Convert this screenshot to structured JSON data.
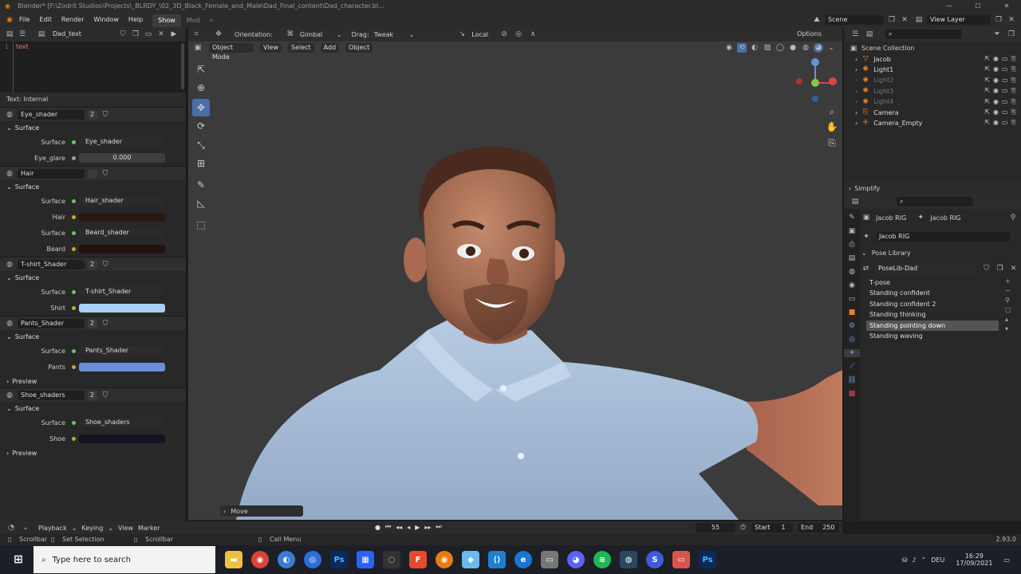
{
  "titlebar": {
    "title": "Blender* [F:\\Zodrit Studios\\Projects\\_BLRDY_\\02_3D_Black_Female_and_Male\\Dad_Final_content\\Dad_character.bl..."
  },
  "menubar": {
    "menus": [
      "File",
      "Edit",
      "Render",
      "Window",
      "Help"
    ],
    "workspaces": [
      "Show",
      "Mod"
    ],
    "scene": "Scene",
    "view_layer": "View Layer"
  },
  "text_editor": {
    "name": "Dad_text",
    "content": "text",
    "footer": "Text: Internal"
  },
  "materials": [
    {
      "name": "Eye_shader",
      "users": "2",
      "section": "Surface",
      "props": [
        {
          "label": "Surface",
          "value": "Eye_shader",
          "kind": "link"
        },
        {
          "label": "Eye_glare",
          "value": "0.000",
          "kind": "number"
        }
      ]
    },
    {
      "name": "Hair",
      "users": "",
      "section": "Surface",
      "props": [
        {
          "label": "Surface",
          "value": "Hair_shader",
          "kind": "link"
        },
        {
          "label": "Hair",
          "value": "",
          "kind": "color",
          "color": "#2a1712"
        },
        {
          "label": "Surface",
          "value": "Beard_shader",
          "kind": "link"
        },
        {
          "label": "Beard",
          "value": "",
          "kind": "color",
          "color": "#211310"
        }
      ]
    },
    {
      "name": "T-shirt_Shader",
      "users": "2",
      "section": "Surface",
      "props": [
        {
          "label": "Surface",
          "value": "T-shirt_Shader",
          "kind": "link"
        },
        {
          "label": "Shirt",
          "value": "",
          "kind": "color",
          "color": "#a9d0f5"
        }
      ]
    },
    {
      "name": "Pants_Shader",
      "users": "2",
      "section": "Surface",
      "props": [
        {
          "label": "Surface",
          "value": "Pants_Shader",
          "kind": "link"
        },
        {
          "label": "Pants",
          "value": "",
          "kind": "color",
          "color": "#6b8fd6"
        }
      ],
      "preview": "Preview"
    },
    {
      "name": "Shoe_shaders",
      "users": "2",
      "section": "Surface",
      "props": [
        {
          "label": "Surface",
          "value": "Shoe_shaders",
          "kind": "link"
        },
        {
          "label": "Shoe",
          "value": "",
          "kind": "color",
          "color": "#13141f"
        }
      ],
      "preview": "Preview"
    }
  ],
  "viewport": {
    "orientation_label": "Orientation:",
    "orientation": "Gimbal",
    "drag_label": "Drag:",
    "drag": "Tweak",
    "transform": "Local",
    "options": "Options",
    "mode": "Object Mode",
    "menus": [
      "View",
      "Select",
      "Add",
      "Object"
    ],
    "last_op": "Move"
  },
  "outliner": {
    "root": "Scene Collection",
    "items": [
      {
        "name": "Jacob",
        "dim": false
      },
      {
        "name": "Light1",
        "dim": false
      },
      {
        "name": "Light2",
        "dim": true
      },
      {
        "name": "Light3",
        "dim": true
      },
      {
        "name": "Light4",
        "dim": true
      },
      {
        "name": "Camera",
        "dim": false
      },
      {
        "name": "Camera_Empty",
        "dim": false
      }
    ]
  },
  "properties": {
    "simplify": "Simplify",
    "breadcrumb_a": "Jacob RIG",
    "breadcrumb_b": "Jacob RIG",
    "armature": "Jacob RIG",
    "pose_library_title": "Pose Library",
    "pose_lib_name": "PoseLib-Dad",
    "poses": [
      "T-pose",
      "Standing confident",
      "Standing confident 2",
      "Standing thinking",
      "Standing pointing down",
      "Standing waving"
    ],
    "selected_pose": 4
  },
  "timeline": {
    "menus": [
      "Playback",
      "Keying",
      "View",
      "Marker"
    ],
    "current_frame": "55",
    "start_label": "Start",
    "start": "1",
    "end_label": "End",
    "end": "250"
  },
  "status": {
    "scrollbar1": "Scrollbar",
    "select": "Set Selection",
    "scrollbar2": "Scrollbar",
    "call_menu": "Call Menu",
    "version": "2.93.0"
  },
  "taskbar": {
    "search_placeholder": "Type here to search",
    "lang": "DEU",
    "time": "16:29",
    "date": "17/09/2021"
  }
}
